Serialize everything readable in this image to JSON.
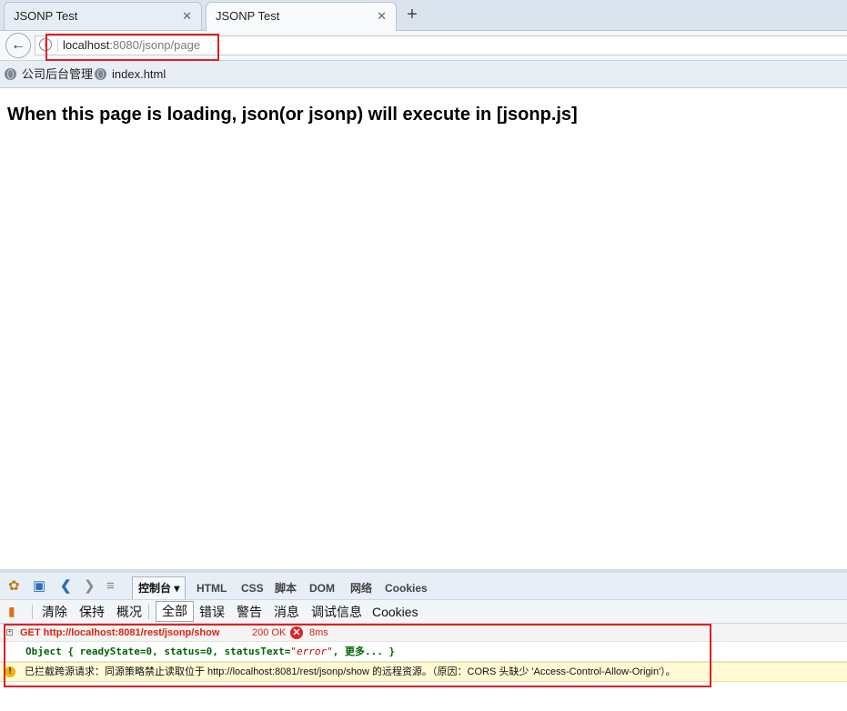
{
  "tabs": [
    {
      "title": "JSONP Test",
      "close": "✕"
    },
    {
      "title": "JSONP Test",
      "close": "✕"
    }
  ],
  "new_tab": "+",
  "url": {
    "host": "localhost",
    "rest": ":8080/jsonp/page"
  },
  "bookmarks": [
    "公司后台管理",
    "index.html"
  ],
  "page": {
    "heading": "When this page is loading, json(or jsonp) will execute in [jsonp.js]"
  },
  "firebug": {
    "tabs": [
      "控制台 ▾",
      "HTML",
      "CSS",
      "脚本",
      "DOM",
      "网络",
      "Cookies"
    ],
    "subtoolbar": [
      "清除",
      "保持",
      "概况",
      "全部",
      "错误",
      "警告",
      "消息",
      "调试信息",
      "Cookies"
    ]
  },
  "console": {
    "request": {
      "line": "GET http://localhost:8081/rest/jsonp/show",
      "status": "200 OK",
      "time": "8ms"
    },
    "object": {
      "prefix": "Object { readyState=0,  status=0,  statusText=",
      "string": "\"error\"",
      "suffix": ",  更多... }"
    },
    "warning": "已拦截跨源请求：同源策略禁止读取位于 http://localhost:8081/rest/jsonp/show 的远程资源。（原因：CORS 头缺少 'Access-Control-Allow-Origin'）。"
  }
}
